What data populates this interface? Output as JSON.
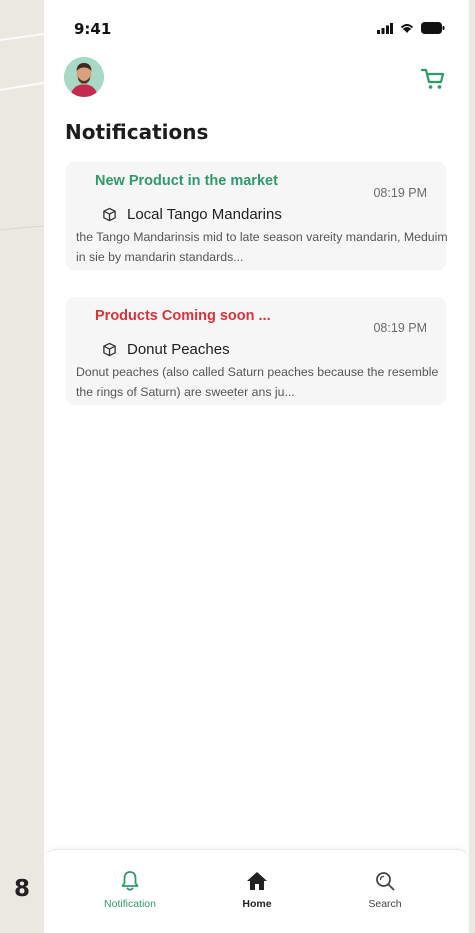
{
  "page_number": "8",
  "status_bar": {
    "time": "9:41"
  },
  "header": {
    "title": "Notifications"
  },
  "notifications": [
    {
      "heading": "New Product in the market",
      "heading_color": "#2e9a68",
      "time": "08:19 PM",
      "product_icon": "box-icon",
      "product_name": "Local Tango Mandarins",
      "description": "the Tango Mandarinsis mid to late season vareity mandarin, Meduim in sie by mandarin standards..."
    },
    {
      "heading": "Products Coming soon ...",
      "heading_color": "#d8343a",
      "time": "08:19 PM",
      "product_icon": "box-icon",
      "product_name": "Donut Peaches",
      "description": "Donut peaches (also called Saturn peaches because the resemble the rings of Saturn) are sweeter ans ju..."
    }
  ],
  "bottom_nav": {
    "items": [
      {
        "label": "Notification",
        "icon": "bell-icon",
        "active": true,
        "color": "#2e9a68"
      },
      {
        "label": "Home",
        "icon": "home-icon",
        "active": false,
        "color": "#222222"
      },
      {
        "label": "Search",
        "icon": "search-icon",
        "active": false,
        "color": "#444444"
      }
    ]
  },
  "colors": {
    "accent": "#2e9a68",
    "alert": "#d8343a"
  }
}
